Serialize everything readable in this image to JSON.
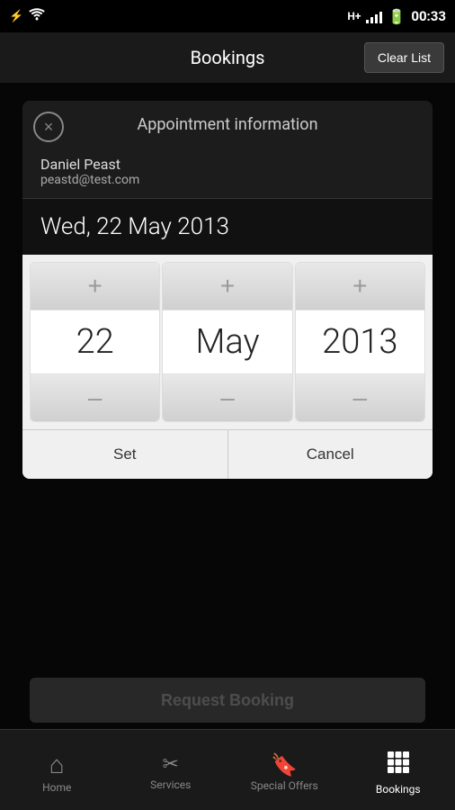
{
  "statusBar": {
    "time": "00:33",
    "networkType": "H+",
    "icons": [
      "usb",
      "wifi",
      "signal",
      "battery"
    ]
  },
  "header": {
    "title": "Bookings",
    "clearListLabel": "Clear List"
  },
  "dialog": {
    "title": "Appointment information",
    "closeLabel": "×",
    "userName": "Daniel Peast",
    "userEmail": "peastd@test.com",
    "dateDisplay": "Wed, 22 May 2013",
    "day": {
      "value": "22",
      "increment": "+",
      "decrement": "–"
    },
    "month": {
      "value": "May",
      "increment": "+",
      "decrement": "–"
    },
    "year": {
      "value": "2013",
      "increment": "+",
      "decrement": "–"
    },
    "setLabel": "Set",
    "cancelLabel": "Cancel"
  },
  "requestBooking": {
    "label": "Request Booking"
  },
  "bottomNav": {
    "items": [
      {
        "id": "home",
        "label": "Home",
        "icon": "⌂",
        "active": false
      },
      {
        "id": "services",
        "label": "Services",
        "icon": "✂",
        "active": false
      },
      {
        "id": "special-offers",
        "label": "Special Offers",
        "icon": "🔖",
        "active": false
      },
      {
        "id": "bookings",
        "label": "Bookings",
        "icon": "▦",
        "active": true
      }
    ]
  }
}
